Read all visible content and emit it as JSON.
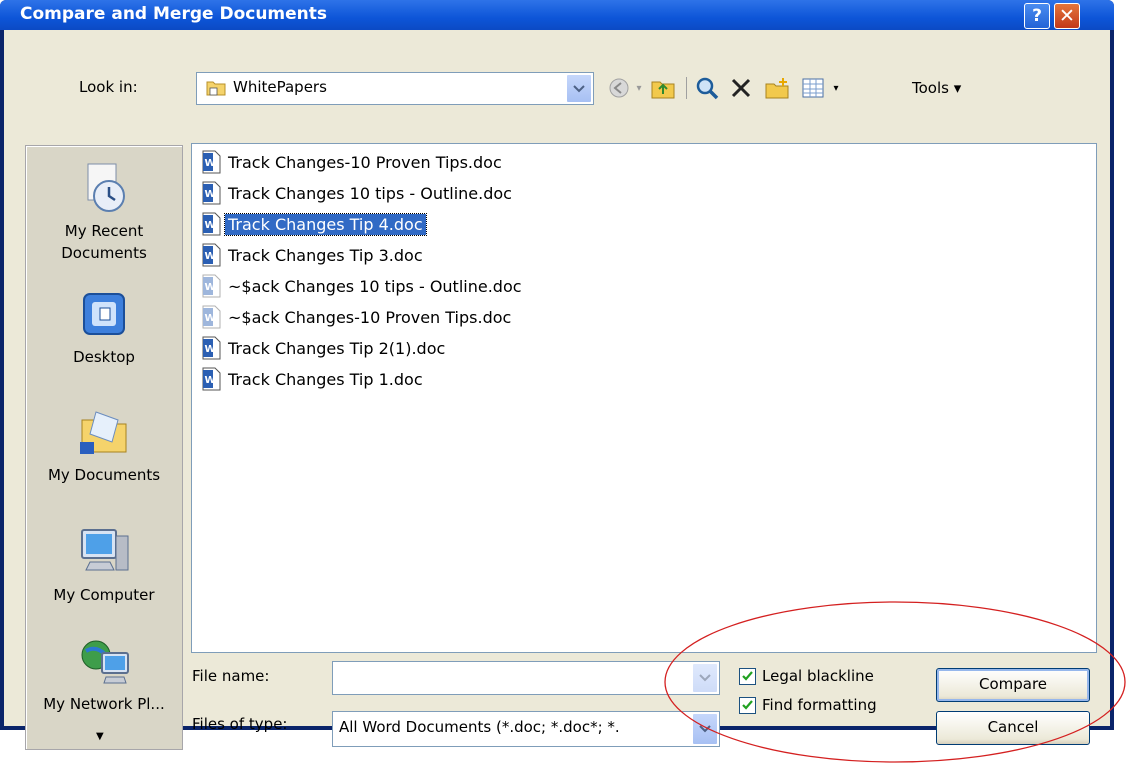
{
  "window": {
    "title": "Compare and Merge Documents",
    "help_label": "?",
    "close_label": "✕"
  },
  "lookin": {
    "label": "Look in:",
    "value": "WhitePapers"
  },
  "toolbar": {
    "tools_label": "Tools ▾",
    "icons": [
      "back-icon",
      "up-folder-icon",
      "search-web-icon",
      "delete-icon",
      "new-folder-icon",
      "views-icon"
    ]
  },
  "places": [
    {
      "label": "My Recent Documents",
      "icon": "recent-documents-icon"
    },
    {
      "label": "Desktop",
      "icon": "desktop-icon"
    },
    {
      "label": "My Documents",
      "icon": "my-documents-icon"
    },
    {
      "label": "My Computer",
      "icon": "my-computer-icon"
    },
    {
      "label": "My Network Pl...",
      "icon": "my-network-icon"
    }
  ],
  "files": [
    {
      "name": "Track Changes-10 Proven Tips.doc",
      "selected": false,
      "temp": false
    },
    {
      "name": "Track Changes 10 tips - Outline.doc",
      "selected": false,
      "temp": false
    },
    {
      "name": "Track Changes Tip 4.doc",
      "selected": true,
      "temp": false
    },
    {
      "name": "Track Changes Tip 3.doc",
      "selected": false,
      "temp": false
    },
    {
      "name": "~$ack Changes 10 tips - Outline.doc",
      "selected": false,
      "temp": true
    },
    {
      "name": "~$ack Changes-10 Proven Tips.doc",
      "selected": false,
      "temp": true
    },
    {
      "name": "Track Changes Tip 2(1).doc",
      "selected": false,
      "temp": false
    },
    {
      "name": "Track Changes Tip 1.doc",
      "selected": false,
      "temp": false
    }
  ],
  "filename": {
    "label": "File name:",
    "value": ""
  },
  "filetype": {
    "label": "Files of type:",
    "value": "All Word Documents (*.doc; *.doc*; *."
  },
  "options": {
    "legal_blackline": {
      "label": "Legal blackline",
      "checked": true
    },
    "find_formatting": {
      "label": "Find formatting",
      "checked": true
    }
  },
  "buttons": {
    "compare": "Compare",
    "cancel": "Cancel"
  },
  "colors": {
    "selection": "#316ac5",
    "titlebar": "#0d55d8",
    "annotation": "#d42020"
  }
}
